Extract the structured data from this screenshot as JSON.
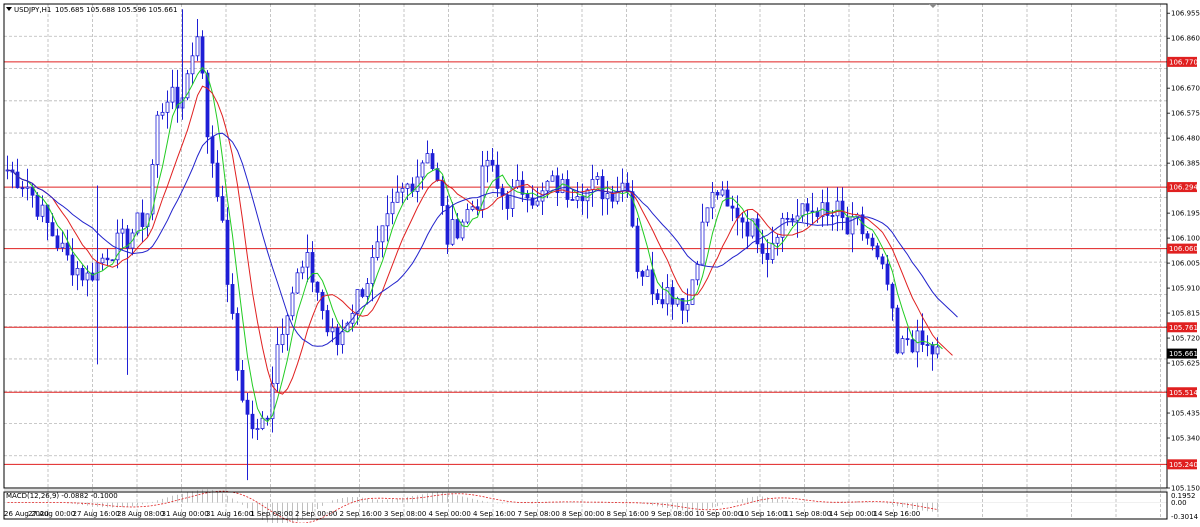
{
  "header": {
    "symbol": "USDJPY,H1",
    "ohlc": "105.685 105.688 105.596 105.661"
  },
  "price_axis": {
    "ticks": [
      "106.955",
      "106.860",
      "106.670",
      "106.575",
      "106.480",
      "106.385",
      "106.195",
      "106.100",
      "106.005",
      "105.910",
      "105.815",
      "105.720",
      "105.625",
      "105.435",
      "105.340",
      "105.150"
    ],
    "current": "105.661"
  },
  "levels": [
    "106.770",
    "106.294",
    "106.060",
    "105.761",
    "105.514",
    "105.240"
  ],
  "macd": {
    "label": "MACD(12,26,9) -0.0882 -0.1000",
    "ticks": [
      "0.1952",
      "0.00",
      "-0.3014"
    ]
  },
  "time_axis": [
    "26 Aug 2020",
    "27 Aug 00:00",
    "27 Aug 16:00",
    "28 Aug 08:00",
    "31 Aug 00:00",
    "31 Aug 16:00",
    "1 Sep 08:00",
    "2 Sep 00:00",
    "2 Sep 16:00",
    "3 Sep 08:00",
    "4 Sep 00:00",
    "4 Sep 16:00",
    "7 Sep 08:00",
    "8 Sep 00:00",
    "8 Sep 16:00",
    "9 Sep 08:00",
    "10 Sep 00:00",
    "10 Sep 16:00",
    "11 Sep 08:00",
    "14 Sep 00:00",
    "14 Sep 16:00"
  ],
  "colors": {
    "candles": "#1f1fd6",
    "level_line": "#e02020",
    "level_box": "#e02020",
    "ma_fast": "#22cc22",
    "ma_mid": "#e02020",
    "ma_slow": "#2222cc",
    "grid": "#b8b8b8",
    "macd_hist": "#c0c0c0",
    "macd_signal": "#e02020"
  },
  "chart_data": {
    "type": "candlestick",
    "instrument": "USDJPY",
    "timeframe": "H1",
    "price_range": [
      105.15,
      106.99
    ],
    "close_path": [
      [
        0,
        106.36
      ],
      [
        4,
        106.3
      ],
      [
        8,
        106.15
      ],
      [
        12,
        106.02
      ],
      [
        16,
        105.95
      ],
      [
        20,
        106.05
      ],
      [
        24,
        106.1
      ],
      [
        28,
        106.2
      ],
      [
        30,
        106.55
      ],
      [
        32,
        106.65
      ],
      [
        34,
        106.6
      ],
      [
        36,
        106.72
      ],
      [
        38,
        106.9
      ],
      [
        40,
        106.5
      ],
      [
        42,
        106.3
      ],
      [
        44,
        105.95
      ],
      [
        46,
        105.6
      ],
      [
        48,
        105.42
      ],
      [
        50,
        105.35
      ],
      [
        52,
        105.45
      ],
      [
        54,
        105.7
      ],
      [
        56,
        105.85
      ],
      [
        58,
        105.95
      ],
      [
        60,
        106.0
      ],
      [
        62,
        105.9
      ],
      [
        64,
        105.75
      ],
      [
        66,
        105.7
      ],
      [
        68,
        105.8
      ],
      [
        70,
        105.88
      ],
      [
        72,
        105.95
      ],
      [
        74,
        106.05
      ],
      [
        76,
        106.15
      ],
      [
        78,
        106.25
      ],
      [
        80,
        106.3
      ],
      [
        82,
        106.35
      ],
      [
        84,
        106.45
      ],
      [
        86,
        106.3
      ],
      [
        88,
        106.1
      ],
      [
        90,
        106.15
      ],
      [
        92,
        106.2
      ],
      [
        94,
        106.25
      ],
      [
        96,
        106.4
      ],
      [
        98,
        106.28
      ],
      [
        100,
        106.25
      ],
      [
        102,
        106.28
      ],
      [
        104,
        106.3
      ],
      [
        106,
        106.22
      ],
      [
        108,
        106.3
      ],
      [
        110,
        106.3
      ],
      [
        112,
        106.28
      ],
      [
        114,
        106.3
      ],
      [
        116,
        106.28
      ],
      [
        118,
        106.3
      ],
      [
        120,
        106.27
      ],
      [
        122,
        106.3
      ],
      [
        124,
        106.32
      ],
      [
        126,
        106.0
      ],
      [
        128,
        105.95
      ],
      [
        130,
        105.9
      ],
      [
        132,
        105.9
      ],
      [
        134,
        105.88
      ],
      [
        136,
        105.85
      ],
      [
        138,
        106.05
      ],
      [
        140,
        106.22
      ],
      [
        142,
        106.28
      ],
      [
        144,
        106.2
      ],
      [
        146,
        106.2
      ],
      [
        148,
        106.15
      ],
      [
        150,
        106.12
      ],
      [
        152,
        106.05
      ],
      [
        154,
        106.15
      ],
      [
        156,
        106.18
      ],
      [
        158,
        106.18
      ],
      [
        160,
        106.2
      ],
      [
        162,
        106.22
      ],
      [
        164,
        106.17
      ],
      [
        166,
        106.2
      ],
      [
        168,
        106.12
      ],
      [
        170,
        106.15
      ],
      [
        172,
        106.1
      ],
      [
        174,
        106.0
      ],
      [
        176,
        105.92
      ],
      [
        178,
        105.65
      ],
      [
        180,
        105.72
      ],
      [
        182,
        105.7
      ],
      [
        184,
        105.68
      ],
      [
        186,
        105.661
      ]
    ],
    "horizontal_levels": [
      106.77,
      106.294,
      106.06,
      105.761,
      105.514,
      105.24
    ],
    "moving_averages": [
      "green",
      "red",
      "blue"
    ],
    "macd": {
      "fast": 12,
      "slow": 26,
      "signal": 9,
      "value": -0.0882,
      "signal_value": -0.1,
      "range": [
        -0.3014,
        0.1952
      ]
    }
  }
}
